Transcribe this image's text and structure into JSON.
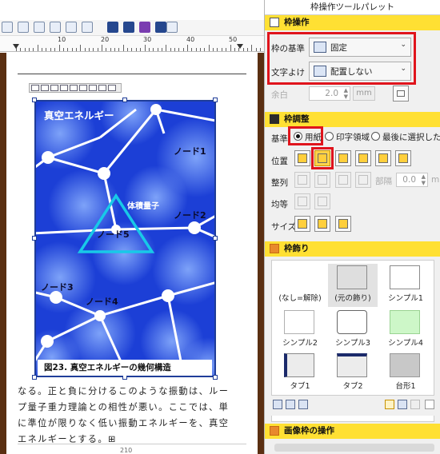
{
  "ruler": {
    "labels": [
      "10",
      "20",
      "30",
      "40",
      "50"
    ]
  },
  "frame": {
    "title": "真空エネルギー",
    "nodes": [
      "ノード1",
      "ノード2",
      "ノード3",
      "ノード4",
      "ノード5"
    ],
    "volume_label": "体積量子",
    "caption": "図23.  真空エネルギーの幾何構造"
  },
  "body": {
    "lines": [
      "なる。正と負に分けるこのような振動は、ルー",
      "プ量子重力理論との相性が悪い。ここでは、単",
      "に準位が限りなく低い振動エネルギーを、真空",
      "エネルギーとする。⊞"
    ],
    "page_number": "210"
  },
  "palette": {
    "title": "枠操作ツールパレット",
    "frame_ops": {
      "header": "枠操作",
      "basis_label": "枠の基準",
      "basis_value": "固定",
      "wrap_label": "文字よけ",
      "wrap_value": "配置しない",
      "margin_label": "余白",
      "margin_value": "2.0",
      "margin_unit": "mm"
    },
    "frame_adjust": {
      "header": "枠調整",
      "basis_label": "基準",
      "radio_options": [
        "用紙",
        "印字領域",
        "最後に選択した枠"
      ],
      "position_label": "位置",
      "align_label": "整列",
      "gap_label": "部隔",
      "gap_value": "0.0",
      "gap_unit": "m",
      "distribute_label": "均等",
      "size_label": "サイズ"
    },
    "frame_decoration": {
      "header": "枠飾り",
      "tiles": [
        "(なし=解除)",
        "(元の飾り)",
        "シンプル1",
        "シンプル2",
        "シンプル3",
        "シンプル4",
        "タブ1",
        "タブ2",
        "台形1"
      ]
    },
    "image_frame_ops": {
      "header": "画像枠の操作"
    }
  }
}
